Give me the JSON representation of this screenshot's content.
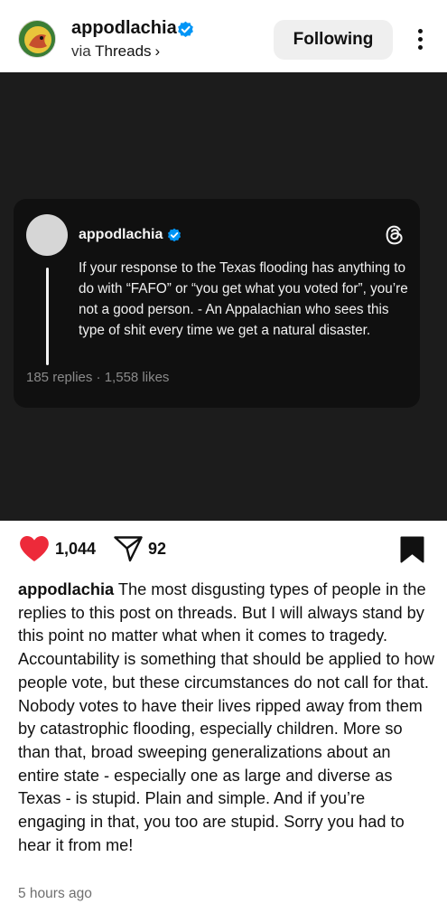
{
  "header": {
    "username": "appodlachia",
    "via_prefix": "via",
    "via_source": "Threads",
    "via_chevron": "›",
    "follow_label": "Following",
    "more_icon": "more-vertical-icon"
  },
  "embedded_thread": {
    "username": "appodlachia",
    "text": "If your response to the Texas flooding has anything to do with “FAFO” or “you get what you voted for”, you’re not a good person. - An Appalachian who sees this type of shit every time we get a natural disaster.",
    "stats": "185 replies · 1,558 likes",
    "logo_icon": "threads-logo-icon"
  },
  "actions": {
    "likes": "1,044",
    "shares": "92",
    "like_icon": "heart-icon",
    "share_icon": "send-icon",
    "save_icon": "bookmark-icon",
    "like_color": "#ed2a3a"
  },
  "caption": {
    "username": "appodlachia",
    "text": "The most disgusting types of people in the replies to this post on threads. But I will always stand by this point no matter what when it comes to tragedy. Accountability is something that should be applied to how people vote, but these circumstances do not call for that. Nobody votes to have their lives ripped away from them by catastrophic flooding, especially children. More so than that, broad sweeping generalizations about an entire state - especially one as large and diverse as Texas - is stupid. Plain and simple. And if you’re engaging in that, you too are stupid.  Sorry you had to hear it from me!",
    "timestamp": "5 hours ago"
  },
  "colors": {
    "verified": "#0095f6",
    "image_background": "#1c1c1c",
    "card_background": "#101010"
  }
}
